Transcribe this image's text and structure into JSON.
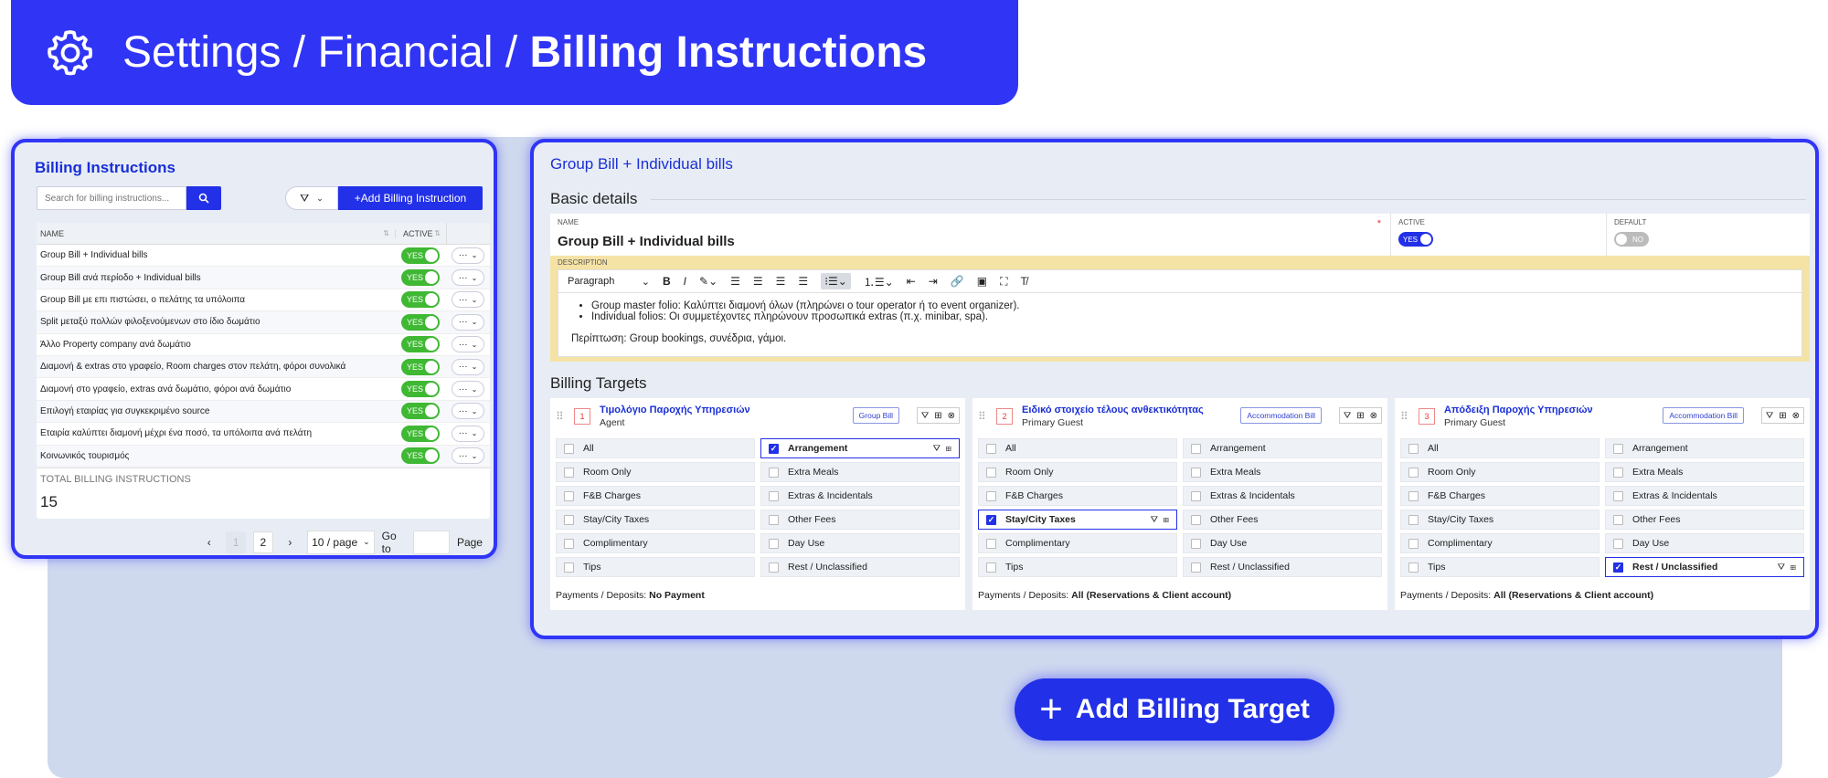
{
  "header": {
    "crumb_pre": "Settings / Financial / ",
    "crumb_current": "Billing Instructions"
  },
  "left": {
    "title": "Billing Instructions",
    "search_placeholder": "Search for billing instructions...",
    "add_label": "+Add Billing Instruction",
    "col_name": "NAME",
    "col_active": "ACTIVE",
    "rows": [
      {
        "name": "Group Bill + Individual bills",
        "active": "YES"
      },
      {
        "name": "Group Bill ανά περίοδο + Individual bills",
        "active": "YES"
      },
      {
        "name": "Group Bill με επι πιστώσει, ο πελάτης τα υπόλοιπα",
        "active": "YES"
      },
      {
        "name": "Split μεταξύ πολλών φιλοξενούμενων στο ίδιο δωμάτιο",
        "active": "YES"
      },
      {
        "name": "Άλλο Property company ανά δωμάτιο",
        "active": "YES"
      },
      {
        "name": "Διαμονή & extras στο γραφείο, Room charges στον πελάτη, φόροι συνολικά",
        "active": "YES"
      },
      {
        "name": "Διαμονή στο γραφείο, extras ανά δωμάτιο, φόροι ανά δωμάτιο",
        "active": "YES"
      },
      {
        "name": "Επιλογή εταιρίας για συγκεκριμένο source",
        "active": "YES"
      },
      {
        "name": "Εταιρία καλύπτει διαμονή μέχρι ένα ποσό, τα υπόλοιπα ανά πελάτη",
        "active": "YES"
      },
      {
        "name": "Κοινωνικός τουρισμός",
        "active": "YES"
      }
    ],
    "total_label": "TOTAL BILLING INSTRUCTIONS",
    "total_value": "15",
    "pager": {
      "p1": "1",
      "p2": "2",
      "per_page": "10 / page",
      "goto": "Go to",
      "page": "Page"
    }
  },
  "right": {
    "title": "Group Bill + Individual bills",
    "basic_title": "Basic details",
    "name_label": "NAME",
    "name_value": "Group Bill + Individual bills",
    "active_label": "ACTIVE",
    "active_value": "YES",
    "default_label": "DEFAULT",
    "default_value": "NO",
    "desc_label": "DESCRIPTION",
    "paragraph": "Paragraph",
    "desc_li1": "Group master folio: Καλύπτει διαμονή όλων (πληρώνει ο tour operator ή το event organizer).",
    "desc_li2": "Individual folios: Οι συμμετέχοντες πληρώνουν προσωπικά extras (π.χ. minibar, spa).",
    "desc_p": "Περίπτωση: Group bookings, συνέδρια, γάμοι.",
    "targets_title": "Billing Targets",
    "targets": [
      {
        "num": "1",
        "name": "Τιμολόγιο Παροχής Υπηρεσιών",
        "sub": "Agent",
        "badge": "Group Bill",
        "payments_label": "Payments / Deposits:",
        "payments_value": "No Payment"
      },
      {
        "num": "2",
        "name": "Ειδικό στοιχείο τέλους ανθεκτικότητας",
        "sub": "Primary Guest",
        "badge": "Accommodation Bill",
        "payments_label": "Payments / Deposits:",
        "payments_value": "All (Reservations & Client account)"
      },
      {
        "num": "3",
        "name": "Απόδειξη Παροχής Υπηρεσιών",
        "sub": "Primary Guest",
        "badge": "Accommodation Bill",
        "payments_label": "Payments / Deposits:",
        "payments_value": "All (Reservations & Client account)"
      }
    ],
    "cats": [
      "All",
      "Arrangement",
      "Room Only",
      "Extra Meals",
      "F&B Charges",
      "Extras & Incidentals",
      "Stay/City Taxes",
      "Other Fees",
      "Complimentary",
      "Day Use",
      "Tips",
      "Rest / Unclassified"
    ]
  },
  "add_target": "Add Billing Target"
}
